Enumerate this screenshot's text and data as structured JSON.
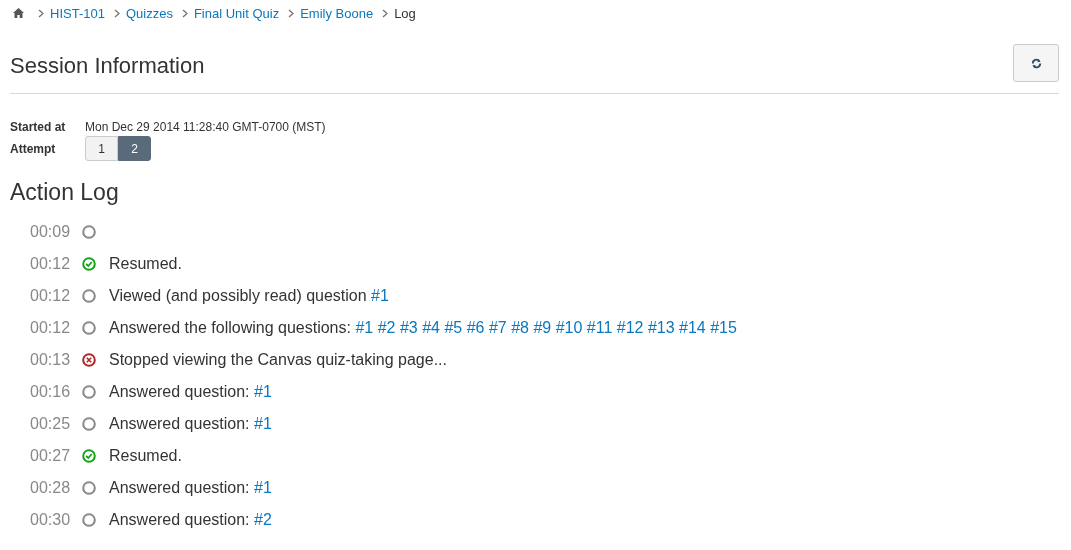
{
  "breadcrumb": [
    {
      "label": "HIST-101",
      "link": true
    },
    {
      "label": "Quizzes",
      "link": true
    },
    {
      "label": "Final Unit Quiz",
      "link": true
    },
    {
      "label": "Emily Boone",
      "link": true
    },
    {
      "label": "Log",
      "link": false
    }
  ],
  "title": "Session Information",
  "started_label": "Started at",
  "started_value": "Mon Dec 29 2014 11:28:40 GMT-0700 (MST)",
  "attempt_label": "Attempt",
  "attempts": [
    {
      "label": "1",
      "selected": false
    },
    {
      "label": "2",
      "selected": true
    }
  ],
  "log_title": "Action Log",
  "entries": [
    {
      "time": "00:09",
      "kind": "event"
    },
    {
      "time": "00:12",
      "kind": "resumed",
      "text": "Resumed."
    },
    {
      "time": "00:12",
      "kind": "event",
      "text": "Viewed (and possibly read) question",
      "links": [
        "#1"
      ]
    },
    {
      "time": "00:12",
      "kind": "event",
      "text": "Answered the following questions:",
      "links": [
        "#1",
        "#2",
        "#3",
        "#4",
        "#5",
        "#6",
        "#7",
        "#8",
        "#9",
        "#10",
        "#11",
        "#12",
        "#13",
        "#14",
        "#15"
      ]
    },
    {
      "time": "00:13",
      "kind": "stopped",
      "text": "Stopped viewing the Canvas quiz-taking page..."
    },
    {
      "time": "00:16",
      "kind": "event",
      "text": "Answered question:",
      "links": [
        "#1"
      ]
    },
    {
      "time": "00:25",
      "kind": "event",
      "text": "Answered question:",
      "links": [
        "#1"
      ]
    },
    {
      "time": "00:27",
      "kind": "resumed",
      "text": "Resumed."
    },
    {
      "time": "00:28",
      "kind": "event",
      "text": "Answered question:",
      "links": [
        "#1"
      ]
    },
    {
      "time": "00:30",
      "kind": "event",
      "text": "Answered question:",
      "links": [
        "#2"
      ]
    }
  ]
}
